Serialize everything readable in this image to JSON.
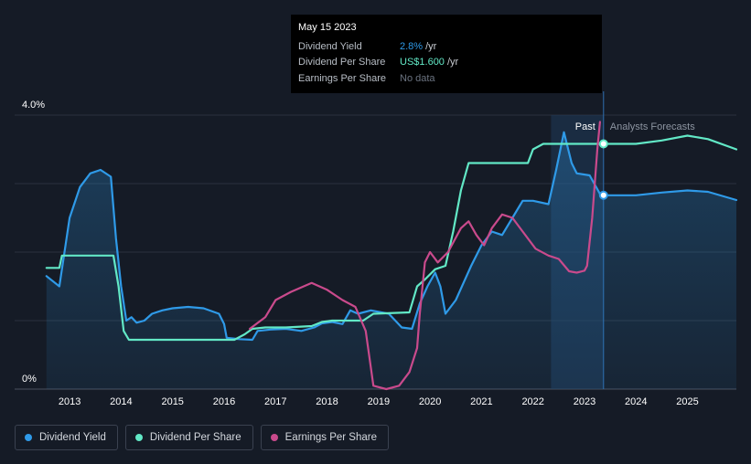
{
  "tooltip": {
    "date": "May 15 2023",
    "rows": [
      {
        "label": "Dividend Yield",
        "value": "2.8%",
        "unit": "/yr"
      },
      {
        "label": "Dividend Per Share",
        "value": "US$1.600",
        "unit": "/yr"
      },
      {
        "label": "Earnings Per Share",
        "value": "No data",
        "unit": ""
      }
    ]
  },
  "legend": [
    {
      "label": "Dividend Yield",
      "color": "#2f9ae8"
    },
    {
      "label": "Dividend Per Share",
      "color": "#62e8c6"
    },
    {
      "label": "Earnings Per Share",
      "color": "#c94a8c"
    }
  ],
  "chart_data": {
    "type": "line",
    "y_tick_labels": [
      "4.0%",
      "0%"
    ],
    "ylim": [
      0,
      4.0
    ],
    "xlim": [
      2012.5,
      2025.95
    ],
    "x_ticks": [
      2013,
      2014,
      2015,
      2016,
      2017,
      2018,
      2019,
      2020,
      2021,
      2022,
      2023,
      2024,
      2025
    ],
    "past_label": "Past",
    "forecast_label": "Analysts Forecasts",
    "forecast_start": 2023.37,
    "highlight_band": [
      2022.35,
      2023.37
    ],
    "grid": true,
    "series": [
      {
        "name": "Dividend Yield",
        "color": "#2f9ae8",
        "fill": true,
        "points": [
          [
            2012.55,
            1.65
          ],
          [
            2012.8,
            1.5
          ],
          [
            2012.9,
            2.0
          ],
          [
            2013.0,
            2.5
          ],
          [
            2013.2,
            2.95
          ],
          [
            2013.4,
            3.15
          ],
          [
            2013.6,
            3.2
          ],
          [
            2013.8,
            3.1
          ],
          [
            2013.9,
            2.2
          ],
          [
            2014.0,
            1.5
          ],
          [
            2014.1,
            1.0
          ],
          [
            2014.2,
            1.05
          ],
          [
            2014.3,
            0.97
          ],
          [
            2014.45,
            1.0
          ],
          [
            2014.6,
            1.1
          ],
          [
            2014.8,
            1.15
          ],
          [
            2015.0,
            1.18
          ],
          [
            2015.3,
            1.2
          ],
          [
            2015.6,
            1.18
          ],
          [
            2015.9,
            1.1
          ],
          [
            2016.0,
            0.95
          ],
          [
            2016.05,
            0.75
          ],
          [
            2016.3,
            0.73
          ],
          [
            2016.55,
            0.72
          ],
          [
            2016.65,
            0.85
          ],
          [
            2016.9,
            0.87
          ],
          [
            2017.2,
            0.88
          ],
          [
            2017.5,
            0.85
          ],
          [
            2017.75,
            0.9
          ],
          [
            2017.9,
            0.96
          ],
          [
            2018.1,
            0.98
          ],
          [
            2018.3,
            0.95
          ],
          [
            2018.45,
            1.15
          ],
          [
            2018.6,
            1.1
          ],
          [
            2018.85,
            1.15
          ],
          [
            2019.2,
            1.1
          ],
          [
            2019.45,
            0.9
          ],
          [
            2019.65,
            0.88
          ],
          [
            2019.8,
            1.25
          ],
          [
            2019.95,
            1.5
          ],
          [
            2020.1,
            1.7
          ],
          [
            2020.2,
            1.5
          ],
          [
            2020.3,
            1.1
          ],
          [
            2020.5,
            1.3
          ],
          [
            2020.8,
            1.8
          ],
          [
            2021.0,
            2.1
          ],
          [
            2021.2,
            2.3
          ],
          [
            2021.4,
            2.25
          ],
          [
            2021.6,
            2.5
          ],
          [
            2021.8,
            2.75
          ],
          [
            2022.0,
            2.75
          ],
          [
            2022.3,
            2.7
          ],
          [
            2022.45,
            3.2
          ],
          [
            2022.6,
            3.75
          ],
          [
            2022.75,
            3.3
          ],
          [
            2022.85,
            3.15
          ],
          [
            2023.1,
            3.12
          ],
          [
            2023.3,
            2.85
          ],
          [
            2023.37,
            2.83
          ],
          [
            2023.6,
            2.83
          ],
          [
            2024.0,
            2.83
          ],
          [
            2024.5,
            2.87
          ],
          [
            2025.0,
            2.9
          ],
          [
            2025.4,
            2.88
          ],
          [
            2025.95,
            2.76
          ]
        ]
      },
      {
        "name": "Dividend Per Share",
        "color": "#62e8c6",
        "fill": false,
        "points": [
          [
            2012.55,
            1.77
          ],
          [
            2012.8,
            1.77
          ],
          [
            2012.85,
            1.95
          ],
          [
            2013.85,
            1.95
          ],
          [
            2013.95,
            1.5
          ],
          [
            2014.05,
            0.85
          ],
          [
            2014.15,
            0.72
          ],
          [
            2016.2,
            0.72
          ],
          [
            2016.4,
            0.8
          ],
          [
            2016.55,
            0.88
          ],
          [
            2016.8,
            0.9
          ],
          [
            2017.2,
            0.9
          ],
          [
            2017.7,
            0.92
          ],
          [
            2017.9,
            0.98
          ],
          [
            2018.1,
            1.0
          ],
          [
            2018.7,
            1.0
          ],
          [
            2018.9,
            1.1
          ],
          [
            2019.6,
            1.12
          ],
          [
            2019.75,
            1.5
          ],
          [
            2019.9,
            1.6
          ],
          [
            2020.1,
            1.75
          ],
          [
            2020.3,
            1.8
          ],
          [
            2020.45,
            2.3
          ],
          [
            2020.6,
            2.9
          ],
          [
            2020.75,
            3.3
          ],
          [
            2021.9,
            3.3
          ],
          [
            2022.0,
            3.5
          ],
          [
            2022.2,
            3.58
          ],
          [
            2023.37,
            3.58
          ],
          [
            2024.0,
            3.58
          ],
          [
            2024.5,
            3.63
          ],
          [
            2025.0,
            3.7
          ],
          [
            2025.4,
            3.65
          ],
          [
            2025.95,
            3.5
          ]
        ]
      },
      {
        "name": "Earnings Per Share",
        "color": "#c94a8c",
        "fill": false,
        "points": [
          [
            2016.5,
            0.88
          ],
          [
            2016.8,
            1.05
          ],
          [
            2017.0,
            1.3
          ],
          [
            2017.3,
            1.42
          ],
          [
            2017.7,
            1.55
          ],
          [
            2018.0,
            1.45
          ],
          [
            2018.3,
            1.3
          ],
          [
            2018.55,
            1.2
          ],
          [
            2018.75,
            0.85
          ],
          [
            2018.9,
            0.05
          ],
          [
            2019.15,
            0.0
          ],
          [
            2019.4,
            0.05
          ],
          [
            2019.6,
            0.25
          ],
          [
            2019.75,
            0.6
          ],
          [
            2019.8,
            1.1
          ],
          [
            2019.9,
            1.85
          ],
          [
            2020.0,
            2.0
          ],
          [
            2020.15,
            1.85
          ],
          [
            2020.35,
            2.0
          ],
          [
            2020.6,
            2.35
          ],
          [
            2020.75,
            2.45
          ],
          [
            2020.9,
            2.25
          ],
          [
            2021.05,
            2.1
          ],
          [
            2021.2,
            2.35
          ],
          [
            2021.4,
            2.55
          ],
          [
            2021.6,
            2.5
          ],
          [
            2021.8,
            2.3
          ],
          [
            2022.05,
            2.05
          ],
          [
            2022.3,
            1.95
          ],
          [
            2022.5,
            1.9
          ],
          [
            2022.7,
            1.72
          ],
          [
            2022.85,
            1.7
          ],
          [
            2023.0,
            1.73
          ],
          [
            2023.05,
            1.8
          ],
          [
            2023.15,
            2.5
          ],
          [
            2023.25,
            3.5
          ],
          [
            2023.3,
            3.9
          ]
        ]
      }
    ],
    "markers": [
      {
        "series": "Dividend Per Share",
        "x": 2023.37,
        "y": 3.58
      },
      {
        "series": "Dividend Yield",
        "x": 2023.37,
        "y": 2.83
      }
    ]
  }
}
